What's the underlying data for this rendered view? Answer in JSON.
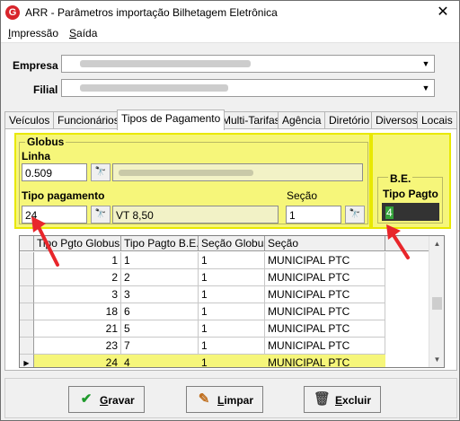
{
  "window": {
    "title": "ARR - Parâmetros importação Bilhetagem Eletrônica",
    "close_glyph": "✕"
  },
  "menu": [
    {
      "label": "Impressão",
      "accel": "I",
      "rest": "mpressão"
    },
    {
      "label": "Saída",
      "accel": "S",
      "rest": "aída"
    }
  ],
  "empresa": {
    "label": "Empresa"
  },
  "filial": {
    "label": "Filial"
  },
  "tabs": [
    "Veículos",
    "Funcionários",
    "Tipos de Pagamento",
    "Multi-Tarifas",
    "Agência",
    "Diretório",
    "Diversos",
    "Locais"
  ],
  "active_tab": "Tipos de Pagamento",
  "globus": {
    "legend": "Globus",
    "linha_label": "Linha",
    "linha_value": "0.509",
    "tipo_pagamento_label": "Tipo pagamento",
    "tipo_pagamento_value": "24",
    "tipo_pagamento_desc": "VT 8,50",
    "secao_label": "Seção",
    "secao_value": "1"
  },
  "be": {
    "legend": "B.E.",
    "tipo_pagto_label": "Tipo Pagto",
    "tipo_pagto_value": "4"
  },
  "grid": {
    "columns": [
      "Tipo Pgto Globus",
      "Tipo Pagto B.E.",
      "Seção Globus",
      "Seção"
    ],
    "rows": [
      [
        "1",
        "1",
        "1",
        "MUNICIPAL PTC"
      ],
      [
        "2",
        "2",
        "1",
        "MUNICIPAL PTC"
      ],
      [
        "3",
        "3",
        "1",
        "MUNICIPAL PTC"
      ],
      [
        "18",
        "6",
        "1",
        "MUNICIPAL PTC"
      ],
      [
        "21",
        "5",
        "1",
        "MUNICIPAL PTC"
      ],
      [
        "23",
        "7",
        "1",
        "MUNICIPAL PTC"
      ],
      [
        "24",
        "4",
        "1",
        "MUNICIPAL PTC"
      ]
    ],
    "selected_row": 6,
    "row_marker": "▶"
  },
  "buttons": {
    "gravar": {
      "label": "Gravar",
      "accel": "G",
      "rest": "ravar",
      "icon": "checkmark-icon"
    },
    "limpar": {
      "label": "Limpar",
      "accel": "L",
      "rest": "impar",
      "icon": "eraser-icon"
    },
    "excluir": {
      "label": "Excluir",
      "accel": "E",
      "rest": "xcluir",
      "icon": "trash-icon"
    }
  },
  "colors": {
    "highlight_yellow": "#f6f67a",
    "annotation_red": "#e8262b",
    "check_green": "#1f9a2c"
  }
}
